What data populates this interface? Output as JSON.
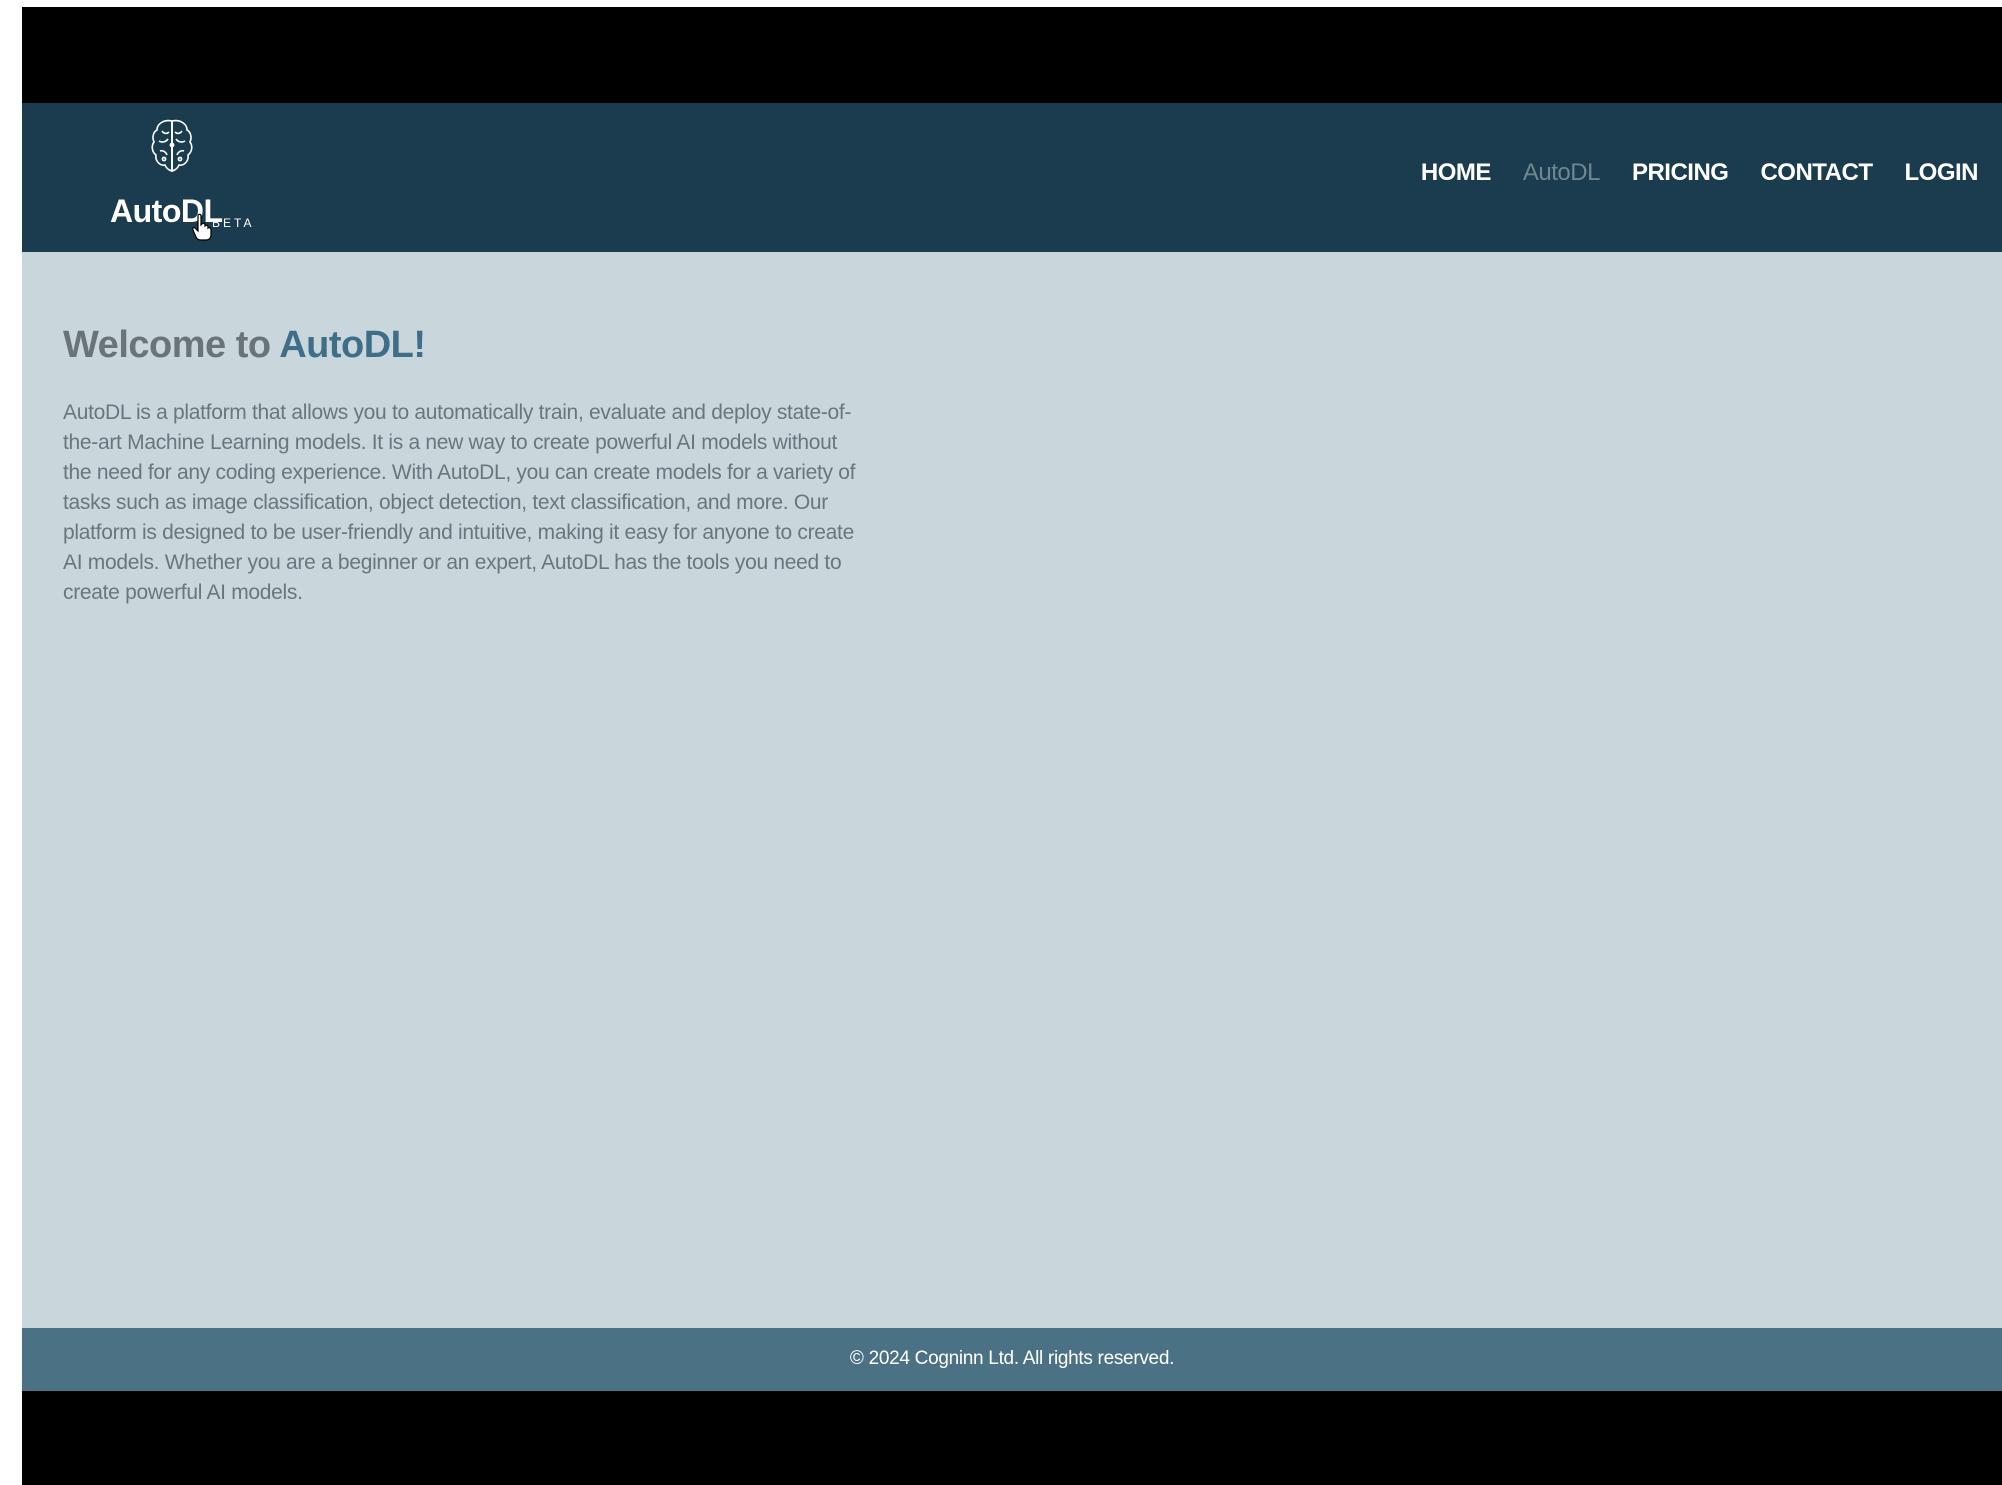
{
  "logo": {
    "name": "AutoDL",
    "badge": "BETA"
  },
  "nav": {
    "items": [
      {
        "label": "HOME",
        "active": false
      },
      {
        "label": "AutoDL",
        "active": true
      },
      {
        "label": "PRICING",
        "active": false
      },
      {
        "label": "CONTACT",
        "active": false
      },
      {
        "label": "LOGIN",
        "active": false
      }
    ]
  },
  "main": {
    "welcome_prefix": "Welcome to ",
    "welcome_brand": "AutoDL!",
    "description": "AutoDL is a platform that allows you to automatically train, evaluate and deploy state-of-the-art Machine Learning models. It is a new way to create powerful AI models without the need for any coding experience. With AutoDL, you can create models for a variety of tasks such as image classification, object detection, text classification, and more. Our platform is designed to be user-friendly and intuitive, making it easy for anyone to create AI models. Whether you are a beginner or an expert, AutoDL has the tools you need to create powerful AI models."
  },
  "footer": {
    "copyright": "© 2024 Cogninn Ltd. All rights reserved."
  },
  "colors": {
    "header_bg": "#1a3c4e",
    "main_bg": "#c9d7dd",
    "footer_bg": "#4a7184",
    "brand_accent": "#3f6f88",
    "nav_active": "#6f8793"
  },
  "icons": {
    "logo_icon": "brain-icon",
    "cursor": "hand-pointer-cursor"
  }
}
